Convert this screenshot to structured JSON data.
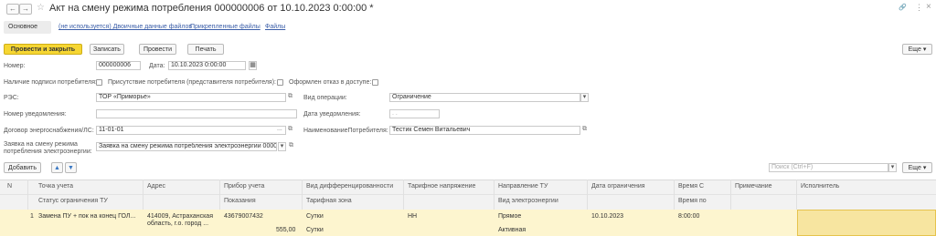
{
  "window": {
    "nav_back": "←",
    "nav_forward": "→",
    "star": "☆",
    "title": "Акт на смену режима потребления 000000006 от 10.10.2023 0:00:00 *",
    "link_icon": "🔗",
    "more": "⋮",
    "close": "×"
  },
  "tabs": {
    "main": "Основное",
    "binary_files": "(не используется) Двоичные данные файлов",
    "attached_files": "Прикрепленные файлы",
    "files": "Файлы"
  },
  "toolbar": {
    "post_close": "Провести и закрыть",
    "save": "Записать",
    "post": "Провести",
    "print": "Печать",
    "more": "Еще ▾"
  },
  "form": {
    "number_label": "Номер:",
    "number_value": "000000006",
    "date_label": "Дата:",
    "date_value": "10.10.2023  0:00:00",
    "consumer_signature_label": "Наличие подписи потребителя:",
    "consumer_presence_label": "Присутствие потребителя (представителя потребителя):",
    "refusal_label": "Оформлен отказ в доступе:",
    "res_label": "РЭС:",
    "res_value": "ТОР «Приморье»",
    "operation_label": "Вид операции:",
    "operation_value": "Ограничение",
    "notice_number_label": "Номер уведомления:",
    "notice_date_label": "Дата уведомления:",
    "notice_date_value": ". .",
    "contract_label": "Договор энергоснабжения/ЛС:",
    "contract_value": "11-01-01",
    "consumer_name_label": "НаименованиеПотребителя:",
    "consumer_name_value": "Тестик Семен Витальевич",
    "request_label_1": "Заявка на смену режима",
    "request_label_2": "потребления электроэнергии:",
    "request_value": "Заявка на смену режима потребления электроэнергии 00000"
  },
  "table_toolbar": {
    "add": "Добавить",
    "up": "▲",
    "down": "▼",
    "search_placeholder": "Поиск (Ctrl+F)",
    "more": "Еще ▾"
  },
  "table": {
    "headers_top": [
      "N",
      "Точка учета",
      "Адрес",
      "Прибор учета",
      "Вид дифференцированности",
      "Тарифное напряжение",
      "Направление ТУ",
      "Дата ограничения",
      "Время С",
      "Примечание",
      "Исполнитель"
    ],
    "headers_bottom": [
      "Статус ограничения ТУ",
      "Показания",
      "Тарифная зона",
      "Вид электроэнергии",
      "Время по"
    ],
    "row": {
      "n": "1",
      "point": "Замена ПУ + пок на конец ГОЛ...",
      "address_1": "414009, Астраханская",
      "address_2": "область, г.о. город ...",
      "meter": "43679007432",
      "reading": "555,00",
      "diff_type": "Сутки",
      "tariff_zone": "Сутки",
      "voltage": "НН",
      "direction": "Прямое",
      "energy_type": "Активная",
      "date": "10.10.2023",
      "time_from": "8:00:00"
    }
  }
}
